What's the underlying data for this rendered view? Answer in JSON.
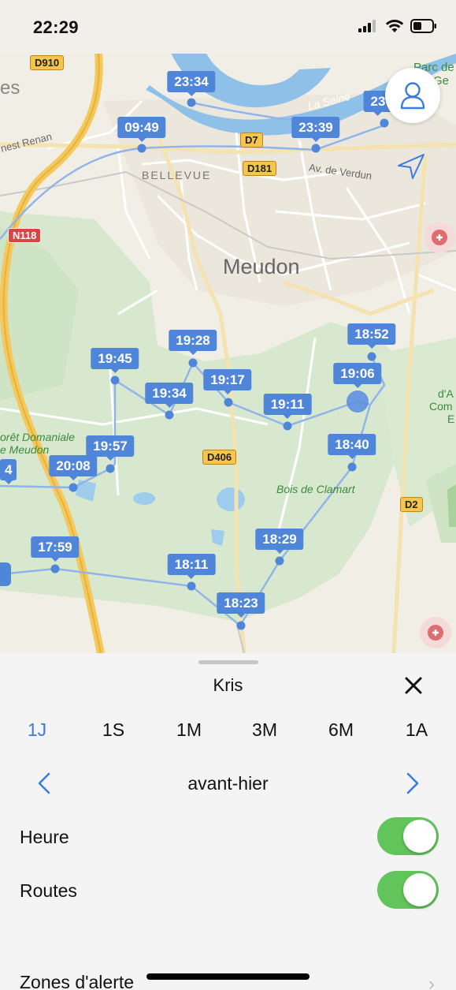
{
  "status_bar": {
    "time": "22:29"
  },
  "map": {
    "place_labels": {
      "bellevue": "BELLEVUE",
      "meudon": "Meudon",
      "bois_clamart": "Bois de Clamart",
      "foret_line1": "orêt Domaniale",
      "foret_line2": "e Meudon",
      "la_seine": "La Seine",
      "av_verdun": "Av. de Verdun",
      "ernest_renan": "nest Renan",
      "es_fragment": "es",
      "parc_line1": "Parc de",
      "parc_line2": "-Ge",
      "right_frag1": "d'A",
      "right_frag2": "Com",
      "right_frag3": "E"
    },
    "road_labels": {
      "d910": "D910",
      "d7": "D7",
      "d181": "D181",
      "n118": "N118",
      "d406": "D406",
      "d2": "D2"
    },
    "time_pins": [
      {
        "time": "23:34"
      },
      {
        "time": "23"
      },
      {
        "time": "09:49"
      },
      {
        "time": "23:39"
      },
      {
        "time": "19:28"
      },
      {
        "time": "18:52"
      },
      {
        "time": "19:45"
      },
      {
        "time": "19:17"
      },
      {
        "time": "19:06"
      },
      {
        "time": "19:34"
      },
      {
        "time": "19:11"
      },
      {
        "time": "19:57"
      },
      {
        "time": "18:40"
      },
      {
        "time": "20:08"
      },
      {
        "time": "4"
      },
      {
        "time": "17:59"
      },
      {
        "time": "18:29"
      },
      {
        "time": "18:11"
      },
      {
        "time": "18:23"
      }
    ]
  },
  "sheet": {
    "title": "Kris",
    "ranges": [
      {
        "label": "1J",
        "active": true
      },
      {
        "label": "1S",
        "active": false
      },
      {
        "label": "1M",
        "active": false
      },
      {
        "label": "3M",
        "active": false
      },
      {
        "label": "6M",
        "active": false
      },
      {
        "label": "1A",
        "active": false
      }
    ],
    "date_label": "avant-hier",
    "toggles": [
      {
        "label": "Heure",
        "on": true
      },
      {
        "label": "Routes",
        "on": true
      }
    ],
    "zones_label": "Zones d'alerte",
    "chevron": "›"
  },
  "colors": {
    "accent": "#3b7be0",
    "pin": "#4f86d9",
    "toggle_on": "#62c55c"
  }
}
